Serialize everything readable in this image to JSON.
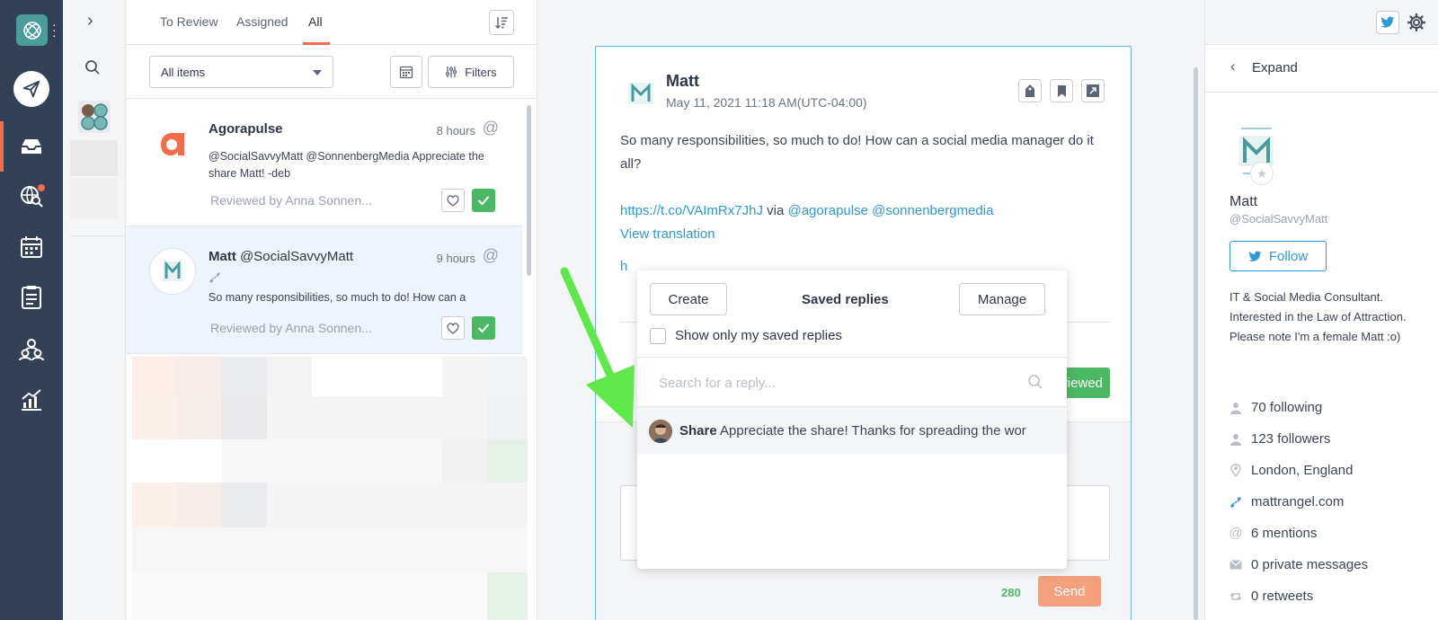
{
  "inbox": {
    "tabs": [
      {
        "label": "To Review"
      },
      {
        "label": "Assigned"
      },
      {
        "label": "All"
      }
    ],
    "filter_select": "All items",
    "filters_label": "Filters",
    "items": [
      {
        "name": "Agorapulse",
        "handle": "",
        "time": "8 hours",
        "text": "@SocialSavvyMatt @SonnenbergMedia Appreciate the share Matt! -deb",
        "reviewed": "Reviewed by Anna Sonnen..."
      },
      {
        "name": "Matt",
        "handle": "@SocialSavvyMatt",
        "time": "9 hours",
        "text": "So many responsibilities, so much to do! How can a",
        "reviewed": "Reviewed by Anna Sonnen..."
      }
    ]
  },
  "post": {
    "author": "Matt",
    "date": "May 11, 2021 11:18 AM(UTC-04:00)",
    "body": "So many responsibilities, so much to do! How can a social media manager do it all?",
    "link": "https://t.co/VAImRx7JhJ",
    "via": "via",
    "mentions": "@agorapulse @sonnenbergmedia",
    "translate": "View translation",
    "partial_link": "h",
    "reviewed_btn": "viewed",
    "char_count": "280",
    "send_label": "Send"
  },
  "saved_replies": {
    "create_label": "Create",
    "title": "Saved replies",
    "manage_label": "Manage",
    "only_mine_label": "Show only my saved replies",
    "search_placeholder": "Search for a reply...",
    "items": [
      {
        "name": "Share",
        "text": "Appreciate the share! Thanks for spreading the wor"
      }
    ]
  },
  "profile": {
    "expand_label": "Expand",
    "name": "Matt",
    "handle": "@SocialSavvyMatt",
    "follow_label": "Follow",
    "bio": "IT & Social Media Consultant. Interested in the Law of Attraction. Please note I'm a female Matt :o)",
    "stats": [
      {
        "icon": "user-icon",
        "label": "70 following"
      },
      {
        "icon": "user-icon",
        "label": "123 followers"
      },
      {
        "icon": "location-icon",
        "label": "London, England"
      },
      {
        "icon": "link-icon",
        "label": "mattrangel.com"
      },
      {
        "icon": "at-icon",
        "label": "6 mentions"
      },
      {
        "icon": "mail-icon",
        "label": "0 private messages"
      },
      {
        "icon": "retweet-icon",
        "label": "0 retweets"
      }
    ]
  },
  "colors": {
    "nav_bg": "#334158",
    "accent": "#f36d4b",
    "success": "#4cb864",
    "link": "#2f98d6",
    "arrow": "#5ee84a"
  }
}
